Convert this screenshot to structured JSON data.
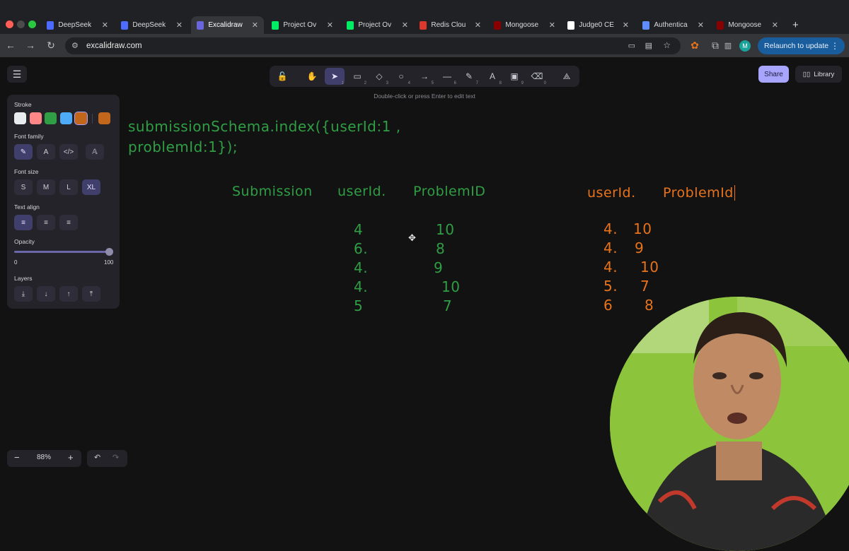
{
  "browser": {
    "tabs": [
      {
        "label": "DeepSeek",
        "icon": "deepseek-icon",
        "color": "#4d6bfe"
      },
      {
        "label": "DeepSeek",
        "icon": "deepseek-icon",
        "color": "#4d6bfe"
      },
      {
        "label": "Excalidraw",
        "icon": "excalidraw-icon",
        "color": "#6965db",
        "active": true
      },
      {
        "label": "Project Ov",
        "icon": "mongodb-leaf-icon",
        "color": "#00ed64"
      },
      {
        "label": "Project Ov",
        "icon": "mongodb-leaf-icon",
        "color": "#00ed64"
      },
      {
        "label": "Redis Clou",
        "icon": "redis-icon",
        "color": "#dc382d"
      },
      {
        "label": "Mongoose",
        "icon": "mongoose-icon",
        "color": "#880000"
      },
      {
        "label": "Judge0 CE",
        "icon": "judge0-icon",
        "color": "#ffffff"
      },
      {
        "label": "Authentica",
        "icon": "auth-icon",
        "color": "#5f8cff"
      },
      {
        "label": "Mongoose",
        "icon": "mongoose-icon",
        "color": "#880000"
      }
    ],
    "new_tab": "+",
    "url": "excalidraw.com",
    "profile_initial": "M",
    "relaunch_label": "Relaunch to update"
  },
  "app": {
    "hint": "Double-click or press Enter to edit text",
    "share_label": "Share",
    "library_label": "Library",
    "tools": [
      {
        "name": "lock",
        "glyph": "🔓",
        "key": ""
      },
      {
        "name": "hand",
        "glyph": "✋",
        "key": ""
      },
      {
        "name": "selection",
        "glyph": "➤",
        "key": "1",
        "selected": true
      },
      {
        "name": "rectangle",
        "glyph": "▭",
        "key": "2"
      },
      {
        "name": "diamond",
        "glyph": "◇",
        "key": "3"
      },
      {
        "name": "ellipse",
        "glyph": "○",
        "key": "4"
      },
      {
        "name": "arrow",
        "glyph": "→",
        "key": "5"
      },
      {
        "name": "line",
        "glyph": "—",
        "key": "6"
      },
      {
        "name": "draw",
        "glyph": "✎",
        "key": "7"
      },
      {
        "name": "text",
        "glyph": "A",
        "key": "8"
      },
      {
        "name": "image",
        "glyph": "▣",
        "key": "9"
      },
      {
        "name": "eraser",
        "glyph": "⌫",
        "key": "0"
      },
      {
        "name": "extra-tools",
        "glyph": "⟁",
        "key": ""
      }
    ]
  },
  "panel": {
    "stroke_label": "Stroke",
    "stroke_colors": [
      "#e9ecef",
      "#ff8787",
      "#2f9e44",
      "#4dabf7",
      "#c2661c"
    ],
    "current_stroke": "#c2661c",
    "font_family_label": "Font family",
    "font_family_options": [
      "✎",
      "A",
      "</>",
      "𝔸"
    ],
    "font_size_label": "Font size",
    "font_sizes": [
      "S",
      "M",
      "L",
      "XL"
    ],
    "text_align_label": "Text align",
    "opacity_label": "Opacity",
    "opacity_min": "0",
    "opacity_max": "100",
    "opacity_value": 1.0,
    "layers_label": "Layers"
  },
  "footer": {
    "zoom_out": "−",
    "zoom_level": "88%",
    "zoom_in": "+",
    "undo": "↶",
    "redo": "↷"
  },
  "drawing": {
    "code_line1": "submissionSchema.index({userId:1 ,",
    "code_line2": "problemId:1});",
    "left_headers": [
      "Submission",
      "userId.",
      "ProblemID"
    ],
    "left_rows": [
      {
        "user": "4",
        "problem": "10"
      },
      {
        "user": "6.",
        "problem": "8"
      },
      {
        "user": "4.",
        "problem": "9"
      },
      {
        "user": "4.",
        "problem": "10"
      },
      {
        "user": "5",
        "problem": "7"
      }
    ],
    "right_headers": [
      "userId.",
      "ProblemId"
    ],
    "right_rows": [
      {
        "user": "4.",
        "problem": "10"
      },
      {
        "user": "4.",
        "problem": "9"
      },
      {
        "user": "4.",
        "problem": "10"
      },
      {
        "user": "5.",
        "problem": "7"
      },
      {
        "user": "6",
        "problem": "8"
      }
    ],
    "green_color": "#2f9e44",
    "orange_color": "#e8731a"
  }
}
